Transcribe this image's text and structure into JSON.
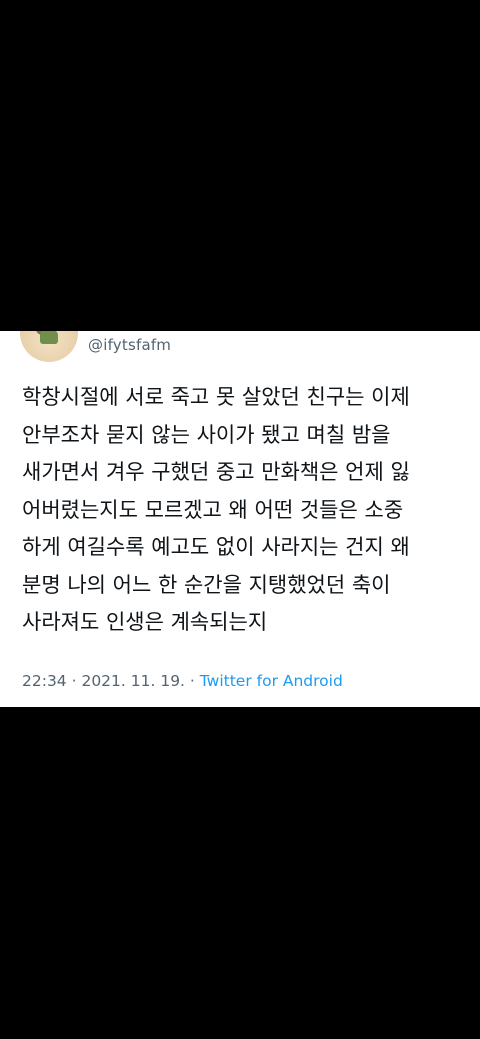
{
  "tweet": {
    "handle": "@ifytsfafm",
    "text_lines": [
      "학창시절에 서로 죽고 못 살았던 친구는 이제",
      "안부조차 묻지 않는 사이가 됐고 며칠 밤을",
      "새가면서 겨우 구했던 중고 만화책은 언제 잃",
      "어버렸는지도 모르겠고 왜 어떤 것들은 소중",
      "하게 여길수록 예고도 없이 사라지는 건지 왜",
      "분명 나의 어느 한 순간을 지탱했었던 축이",
      "사라져도 인생은 계속되는지"
    ],
    "time": "22:34",
    "date": "2021. 11. 19.",
    "separator": " · ",
    "source": "Twitter for Android"
  },
  "colors": {
    "background": "#000000",
    "card": "#ffffff",
    "text": "#0f1419",
    "secondary": "#536471",
    "link": "#1d9bf0"
  }
}
